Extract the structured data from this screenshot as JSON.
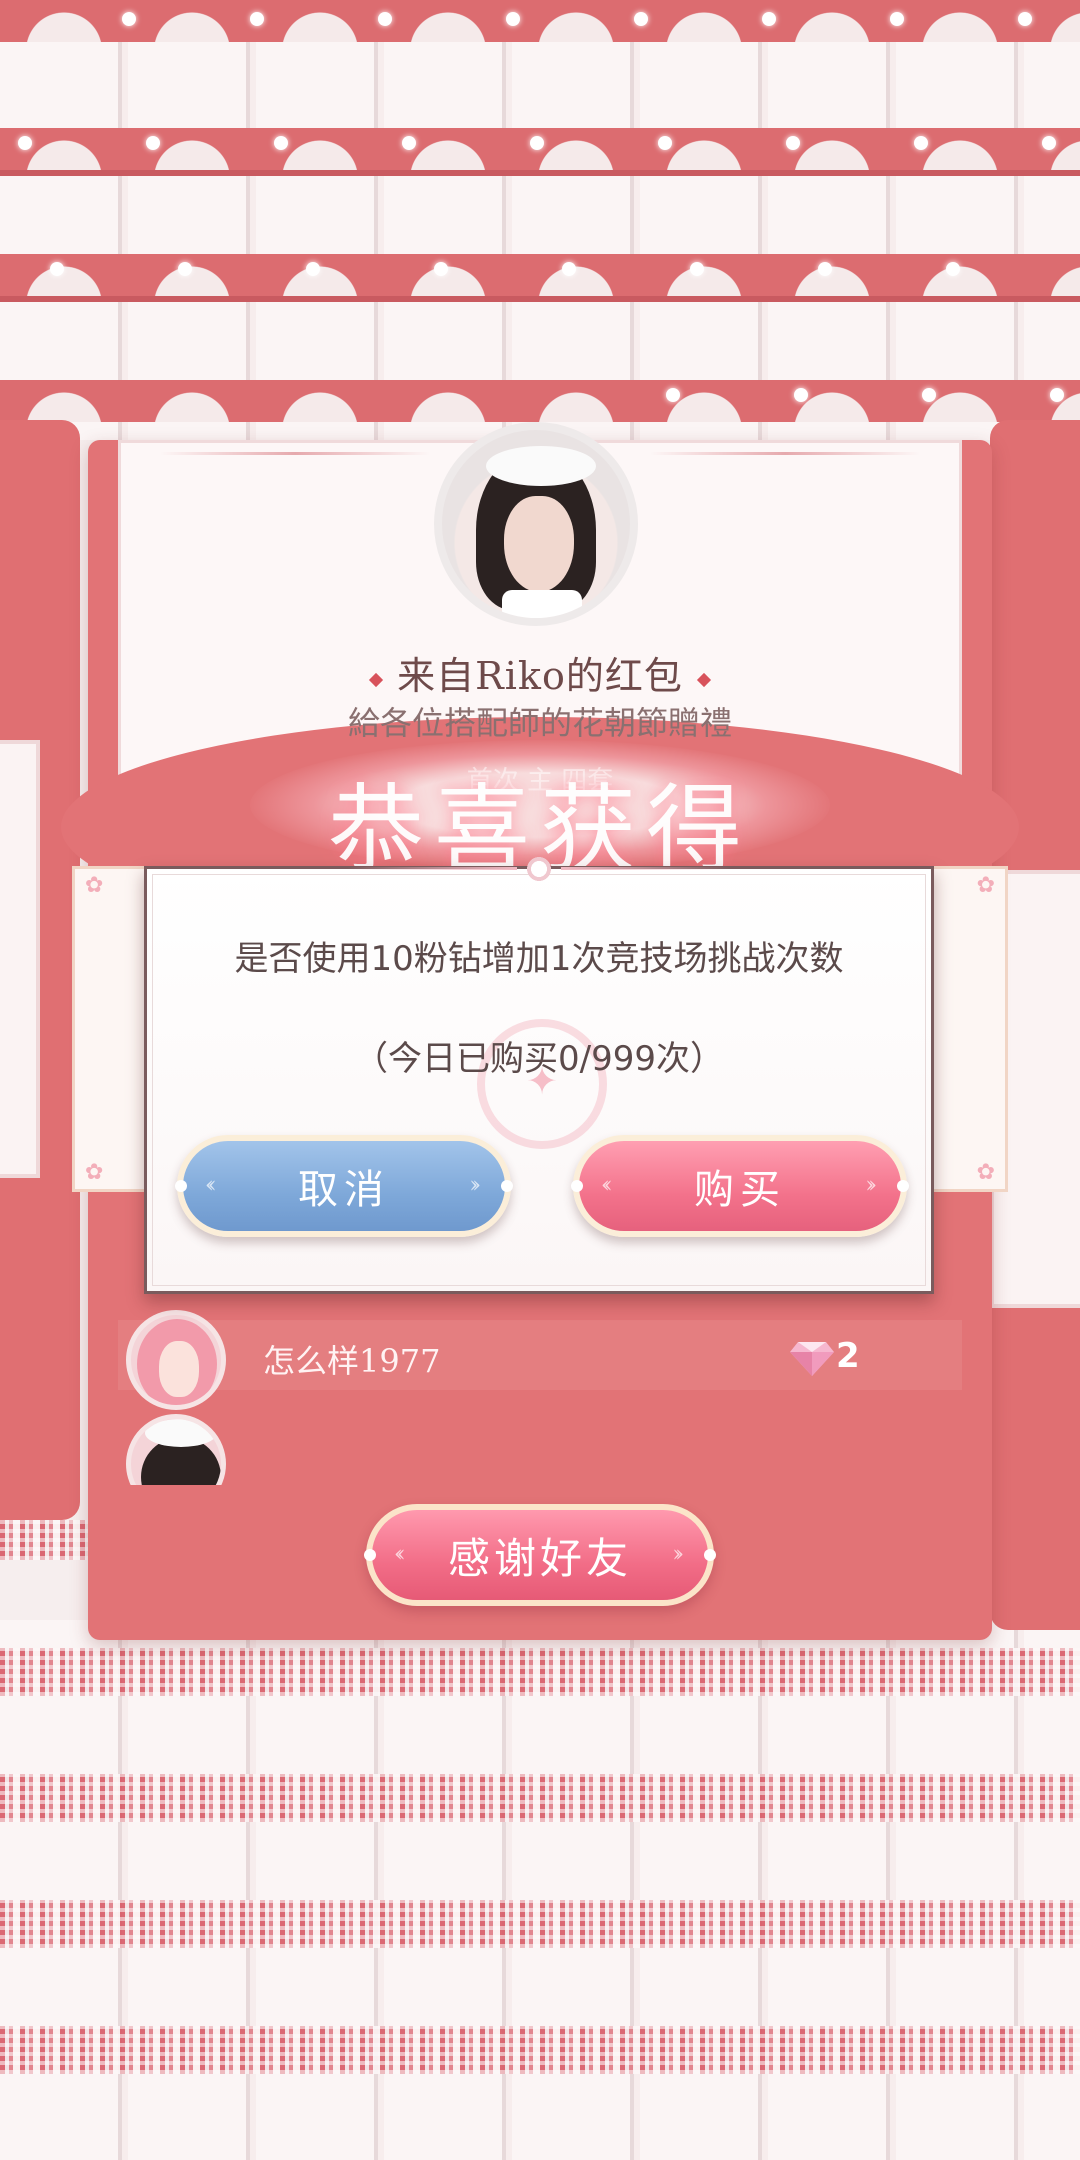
{
  "envelope": {
    "sender_title": "来自Riko的红包",
    "subtitle": "給各位搭配師的花朝節贈禮",
    "congrats": "恭喜获得",
    "congrats_sub": "首次 主 四套"
  },
  "list": {
    "rows": [
      {
        "name": "怎么样1977",
        "count": "2"
      }
    ]
  },
  "thanks_button": "感谢好友",
  "dialog": {
    "message": "是否使用10粉钻增加1次竞技场挑战次数",
    "note": "（今日已购买0/999次）",
    "cancel_label": "取消",
    "buy_label": "购买"
  },
  "colors": {
    "envelope_red": "#e27376",
    "cancel_blue": "#7ea8d9",
    "buy_pink": "#f3728b",
    "text_dark": "#5b4a4a"
  },
  "icons": [
    "diamond-gem-icon",
    "sparkle-emblem-icon"
  ]
}
